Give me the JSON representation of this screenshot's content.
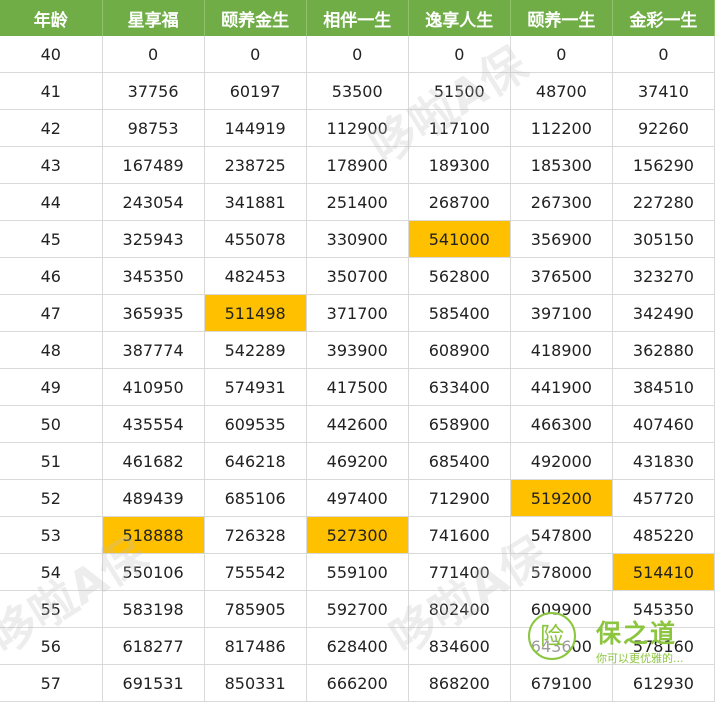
{
  "headers": [
    "年龄",
    "星享福",
    "颐养金生",
    "相伴一生",
    "逸享人生",
    "颐养一生",
    "金彩一生"
  ],
  "rows": [
    [
      "40",
      "0",
      "0",
      "0",
      "0",
      "0",
      "0"
    ],
    [
      "41",
      "37756",
      "60197",
      "53500",
      "51500",
      "48700",
      "37410"
    ],
    [
      "42",
      "98753",
      "144919",
      "112900",
      "117100",
      "112200",
      "92260"
    ],
    [
      "43",
      "167489",
      "238725",
      "178900",
      "189300",
      "185300",
      "156290"
    ],
    [
      "44",
      "243054",
      "341881",
      "251400",
      "268700",
      "267300",
      "227280"
    ],
    [
      "45",
      "325943",
      "455078",
      "330900",
      "541000",
      "356900",
      "305150"
    ],
    [
      "46",
      "345350",
      "482453",
      "350700",
      "562800",
      "376500",
      "323270"
    ],
    [
      "47",
      "365935",
      "511498",
      "371700",
      "585400",
      "397100",
      "342490"
    ],
    [
      "48",
      "387774",
      "542289",
      "393900",
      "608900",
      "418900",
      "362880"
    ],
    [
      "49",
      "410950",
      "574931",
      "417500",
      "633400",
      "441900",
      "384510"
    ],
    [
      "50",
      "435554",
      "609535",
      "442600",
      "658900",
      "466300",
      "407460"
    ],
    [
      "51",
      "461682",
      "646218",
      "469200",
      "685400",
      "492000",
      "431830"
    ],
    [
      "52",
      "489439",
      "685106",
      "497400",
      "712900",
      "519200",
      "457720"
    ],
    [
      "53",
      "518888",
      "726328",
      "527300",
      "741600",
      "547800",
      "485220"
    ],
    [
      "54",
      "550106",
      "755542",
      "559100",
      "771400",
      "578000",
      "514410"
    ],
    [
      "55",
      "583198",
      "785905",
      "592700",
      "802400",
      "609900",
      "545350"
    ],
    [
      "56",
      "618277",
      "817486",
      "628400",
      "834600",
      "643600",
      "578160"
    ],
    [
      "57",
      "691531",
      "850331",
      "666200",
      "868200",
      "679100",
      "612930"
    ]
  ],
  "highlights": [
    [
      5,
      4
    ],
    [
      7,
      2
    ],
    [
      12,
      5
    ],
    [
      13,
      1
    ],
    [
      13,
      3
    ],
    [
      14,
      6
    ]
  ],
  "colors": {
    "header_bg": "#70ad47",
    "highlight": "#ffc000",
    "brand": "#8cc63f"
  },
  "watermark": "哆啦A保",
  "logo": {
    "mark": "险",
    "name": "保之道",
    "slogan": "你可以更优雅的..."
  }
}
